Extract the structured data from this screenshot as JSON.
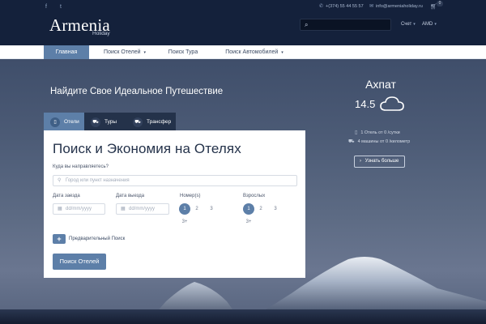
{
  "topbar": {
    "social": [
      "f",
      "t"
    ],
    "phone": "+(374) 55 44 55 57",
    "email": "info@armeniaholiday.ru",
    "cart_count": "0",
    "search_placeholder": "",
    "account_label": "Счет",
    "currency_label": "AMD"
  },
  "logo": {
    "name": "Armenia",
    "tagline": "Holiday"
  },
  "nav": {
    "items": [
      {
        "label": "Главная"
      },
      {
        "label": "Поиск Отелей"
      },
      {
        "label": "Поиск Тура"
      },
      {
        "label": "Поиск Автомобилей"
      }
    ]
  },
  "hero": {
    "title": "Найдите Свое Идеальное Путешествие"
  },
  "weather": {
    "city": "Ахпат",
    "temperature": "14.5",
    "hotels_line": "1 Отель от 0 /сутки",
    "cars_line": "4 машины от 0 /километр",
    "more_button": "Узнать больше"
  },
  "tabs": [
    {
      "label": "Отели"
    },
    {
      "label": "Туры"
    },
    {
      "label": "Трансфер"
    }
  ],
  "form": {
    "title": "Поиск и Экономия на Отелях",
    "destination_label": "Куда вы направляетесь?",
    "destination_placeholder": "Город или пункт назначения",
    "checkin_label": "Дата заезда",
    "checkin_placeholder": "dd/mm/yyyy",
    "checkout_label": "Дата выезда",
    "checkout_placeholder": "dd/mm/yyyy",
    "rooms_label": "Номер(s)",
    "rooms_options": [
      "1",
      "2",
      "3",
      "3+"
    ],
    "adults_label": "Взрослых",
    "adults_options": [
      "1",
      "2",
      "3",
      "3+"
    ],
    "advanced_label": "Предварительный Поиск",
    "advanced_icon": "+",
    "submit_label": "Поиск Отелей"
  },
  "colors": {
    "accent": "#5d7fa8",
    "topbar": "#14213b",
    "tab_dark": "#24324a"
  }
}
